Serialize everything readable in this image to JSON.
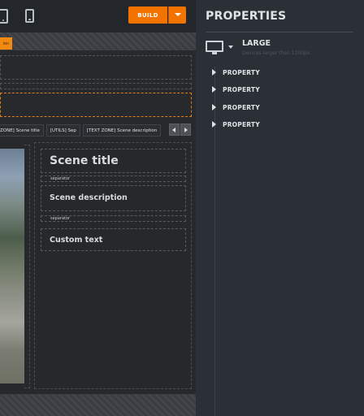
{
  "toolbar": {
    "build_label": "BUILD",
    "devices": [
      "tablet-icon",
      "phone-icon"
    ]
  },
  "canvas": {
    "tag_label": "ion",
    "breadcrumbs": [
      "ZONE] Scene title",
      "[UTILS] Sep",
      "[TEXT ZONE] Scene description"
    ],
    "scene_title": "Scene title",
    "separator1": "separator",
    "scene_description": "Scene description",
    "separator2": "separator",
    "custom_text": "Custom text"
  },
  "panel": {
    "title": "PROPERTIES",
    "device_size": "LARGE",
    "device_subtitle": "Devices larger than 1200px",
    "properties": [
      "PROPERTY",
      "PROPERTY",
      "PROPERTY",
      "PROPERTY"
    ]
  },
  "colors": {
    "accent": "#f27300",
    "panel_bg": "#2b3036",
    "canvas_bg": "#26282a"
  }
}
